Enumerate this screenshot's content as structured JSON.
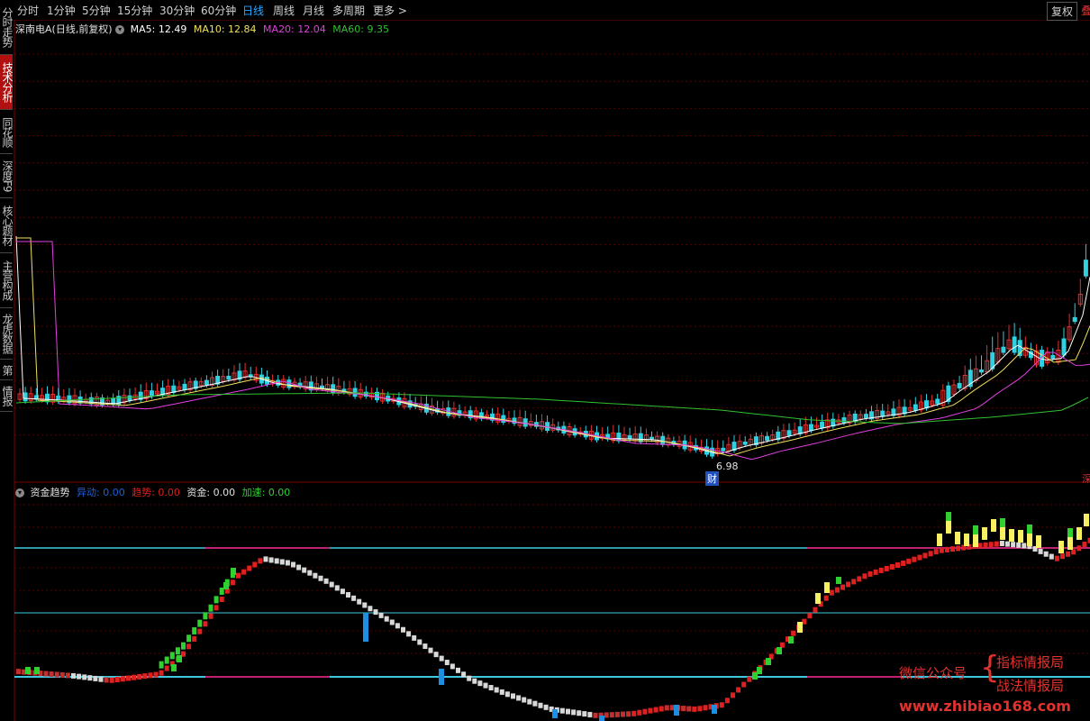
{
  "toolbar": {
    "periods": [
      "分时",
      "1分钟",
      "5分钟",
      "15分钟",
      "30分钟",
      "60分钟",
      "日线",
      "周线",
      "月线",
      "多周期",
      "更多"
    ],
    "active_period": "日线",
    "more_arrow": ">",
    "adjust_button": "复权",
    "edge_char": "叠"
  },
  "sidebar": {
    "items": [
      "分时走势",
      "技术分析",
      "同花顺",
      "深度F9",
      "核心题材",
      "主营构成",
      "龙虎数据",
      "第",
      "情报"
    ],
    "active_index": 1
  },
  "main_chart": {
    "stock_label": "深南电A(日线,前复权)",
    "ma_labels": [
      "MA5: 12.49",
      "MA10: 12.84",
      "MA20: 12.04",
      "MA60: 9.35"
    ],
    "low_marker": "6.98",
    "finance_marker": "财",
    "right_edge_char": "深",
    "colors": {
      "ma5": "#ffffff",
      "ma10": "#f0e060",
      "ma20": "#e040e0",
      "ma60": "#30c030",
      "up": "#e03030",
      "down": "#30d0e0",
      "grid": "#5a0000"
    }
  },
  "indicator": {
    "name": "资金趋势",
    "labels": [
      {
        "name": "异动",
        "value": "0.00",
        "color": "#1e5fd8"
      },
      {
        "name": "趋势",
        "value": "0.00",
        "color": "#e02020"
      },
      {
        "name": "资金",
        "value": "0.00",
        "color": "#e0e0e0"
      },
      {
        "name": "加速",
        "value": "0.00",
        "color": "#30d030"
      }
    ]
  },
  "watermark": {
    "wechat": "微信公众号",
    "brace": "{",
    "line1": "指标情报局",
    "line2": "战法情报局",
    "url": "www.zhibiao168.com"
  },
  "chart_data": {
    "type": "candlestick",
    "panels": [
      {
        "name": "main",
        "series": [
          {
            "name": "MA5",
            "value": 12.49,
            "color": "#ffffff"
          },
          {
            "name": "MA10",
            "value": 12.84,
            "color": "#f0e060"
          },
          {
            "name": "MA20",
            "value": 12.04,
            "color": "#e040e0"
          },
          {
            "name": "MA60",
            "value": 9.35,
            "color": "#30c030"
          }
        ],
        "annotations": [
          "6.98",
          "财"
        ],
        "grid": true
      },
      {
        "name": "资金趋势",
        "series": [
          {
            "name": "异动",
            "value": 0.0
          },
          {
            "name": "趋势",
            "value": 0.0
          },
          {
            "name": "资金",
            "value": 0.0
          },
          {
            "name": "加速",
            "value": 0.0
          }
        ]
      }
    ]
  }
}
